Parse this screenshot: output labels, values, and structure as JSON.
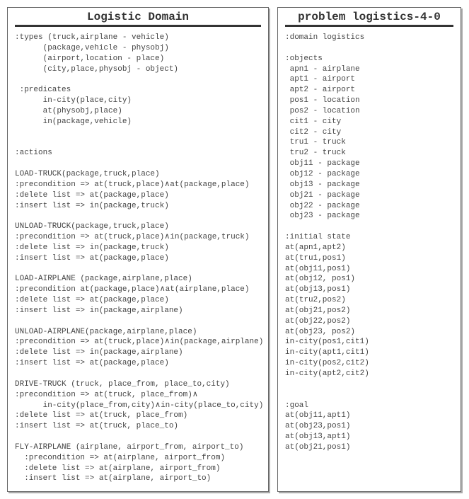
{
  "left": {
    "title": "Logistic Domain",
    "body": ":types (truck,airplane - vehicle)\n      (package,vehicle - physobj)\n      (airport,location - place)\n      (city,place,physobj - object)\n\n :predicates\n      in-city(place,city)\n      at(physobj,place)\n      in(package,vehicle)\n\n\n:actions\n\nLOAD-TRUCK(package,truck,place)\n:precondition => at(truck,place)∧at(package,place)\n:delete list => at(package,place)\n:insert list => in(package,truck)\n\nUNLOAD-TRUCK(package,truck,place)\n:precondition => at(truck,place)∧in(package,truck)\n:delete list => in(package,truck)\n:insert list => at(package,place)\n\nLOAD-AIRPLANE (package,airplane,place)\n:precondition at(package,place)∧at(airplane,place)\n:delete list => at(package,place)\n:insert list => in(package,airplane)\n\nUNLOAD-AIRPLANE(package,airplane,place)\n:precondition => at(truck,place)∧in(package,airplane)\n:delete list => in(package,airplane)\n:insert list => at(package,place)\n\nDRIVE-TRUCK (truck, place_from, place_to,city)\n:precondition => at(truck, place_from)∧\n      in-city(place_from,city)∧in-city(place_to,city)\n:delete list => at(truck, place_from)\n:insert list => at(truck, place_to)\n\nFLY-AIRPLANE (airplane, airport_from, airport_to)\n  :precondition => at(airplane, airport_from)\n  :delete list => at(airplane, airport_from)\n  :insert list => at(airplane, airport_to)"
  },
  "right": {
    "title": "problem logistics-4-0",
    "body": ":domain logistics\n\n:objects\n apn1 - airplane\n apt1 - airport\n apt2 - airport\n pos1 - location\n pos2 - location\n cit1 - city\n cit2 - city\n tru1 - truck\n tru2 - truck\n obj11 - package\n obj12 - package\n obj13 - package\n obj21 - package\n obj22 - package\n obj23 - package\n\n:initial state\nat(apn1,apt2)\nat(tru1,pos1)\nat(obj11,pos1)\nat(obj12, pos1)\nat(obj13,pos1)\nat(tru2,pos2)\nat(obj21,pos2)\nat(obj22,pos2)\nat(obj23, pos2)\nin-city(pos1,cit1)\nin-city(apt1,cit1)\nin-city(pos2,cit2)\nin-city(apt2,cit2)\n\n\n:goal\nat(obj11,apt1)\nat(obj23,pos1)\nat(obj13,apt1)\nat(obj21,pos1)"
  }
}
